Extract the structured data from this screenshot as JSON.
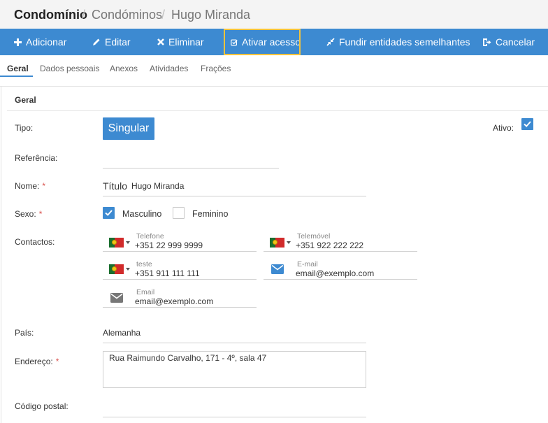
{
  "breadcrumb": {
    "root": "Condomínio",
    "level2": "Condóminos",
    "current": "Hugo Miranda",
    "separator": "/"
  },
  "toolbar": {
    "add": "Adicionar",
    "edit": "Editar",
    "delete": "Eliminar",
    "activate": "Ativar acesso",
    "merge": "Fundir entidades semelhantes",
    "cancel": "Cancelar"
  },
  "tabs": [
    {
      "label": "Geral",
      "active": true
    },
    {
      "label": "Dados pessoais",
      "active": false
    },
    {
      "label": "Anexos",
      "active": false
    },
    {
      "label": "Atividades",
      "active": false
    },
    {
      "label": "Frações",
      "active": false
    }
  ],
  "section_title": "Geral",
  "form": {
    "tipo_label": "Tipo:",
    "tipo_value": "Singular",
    "ativo_label": "Ativo:",
    "ativo_checked": true,
    "referencia_label": "Referência:",
    "referencia_value": "",
    "nome_label": "Nome:",
    "nome_prefix": "Título",
    "nome_value": "Hugo Miranda",
    "sexo_label": "Sexo:",
    "sexo_options": [
      {
        "label": "Masculino",
        "checked": true
      },
      {
        "label": "Feminino",
        "checked": false
      }
    ],
    "contactos_label": "Contactos:",
    "contacts": {
      "telefone": {
        "label": "Telefone",
        "value": "+351 22 999 9999",
        "icon": "portugal-flag-icon"
      },
      "telemovel": {
        "label": "Telemóvel",
        "value": "+351 922 222 222",
        "icon": "portugal-flag-icon"
      },
      "teste": {
        "label": "teste",
        "value": "+351 911 111 111",
        "icon": "portugal-flag-icon"
      },
      "email1": {
        "label": "E-mail",
        "value": "email@exemplo.com",
        "icon": "envelope-icon",
        "color": "#3d8ad1"
      },
      "email2": {
        "label": "Email",
        "value": "email@exemplo.com",
        "icon": "envelope-icon",
        "color": "#777777"
      }
    },
    "pais_label": "País:",
    "pais_value": "Alemanha",
    "endereco_label": "Endereço:",
    "endereco_value": "Rua Raimundo Carvalho, 171 - 4º, sala 47",
    "codigo_postal_label": "Código postal:",
    "required_mark": "*"
  },
  "colors": {
    "accent": "#3d8ad1",
    "highlight": "#f3c33c",
    "required": "#d9534f"
  }
}
